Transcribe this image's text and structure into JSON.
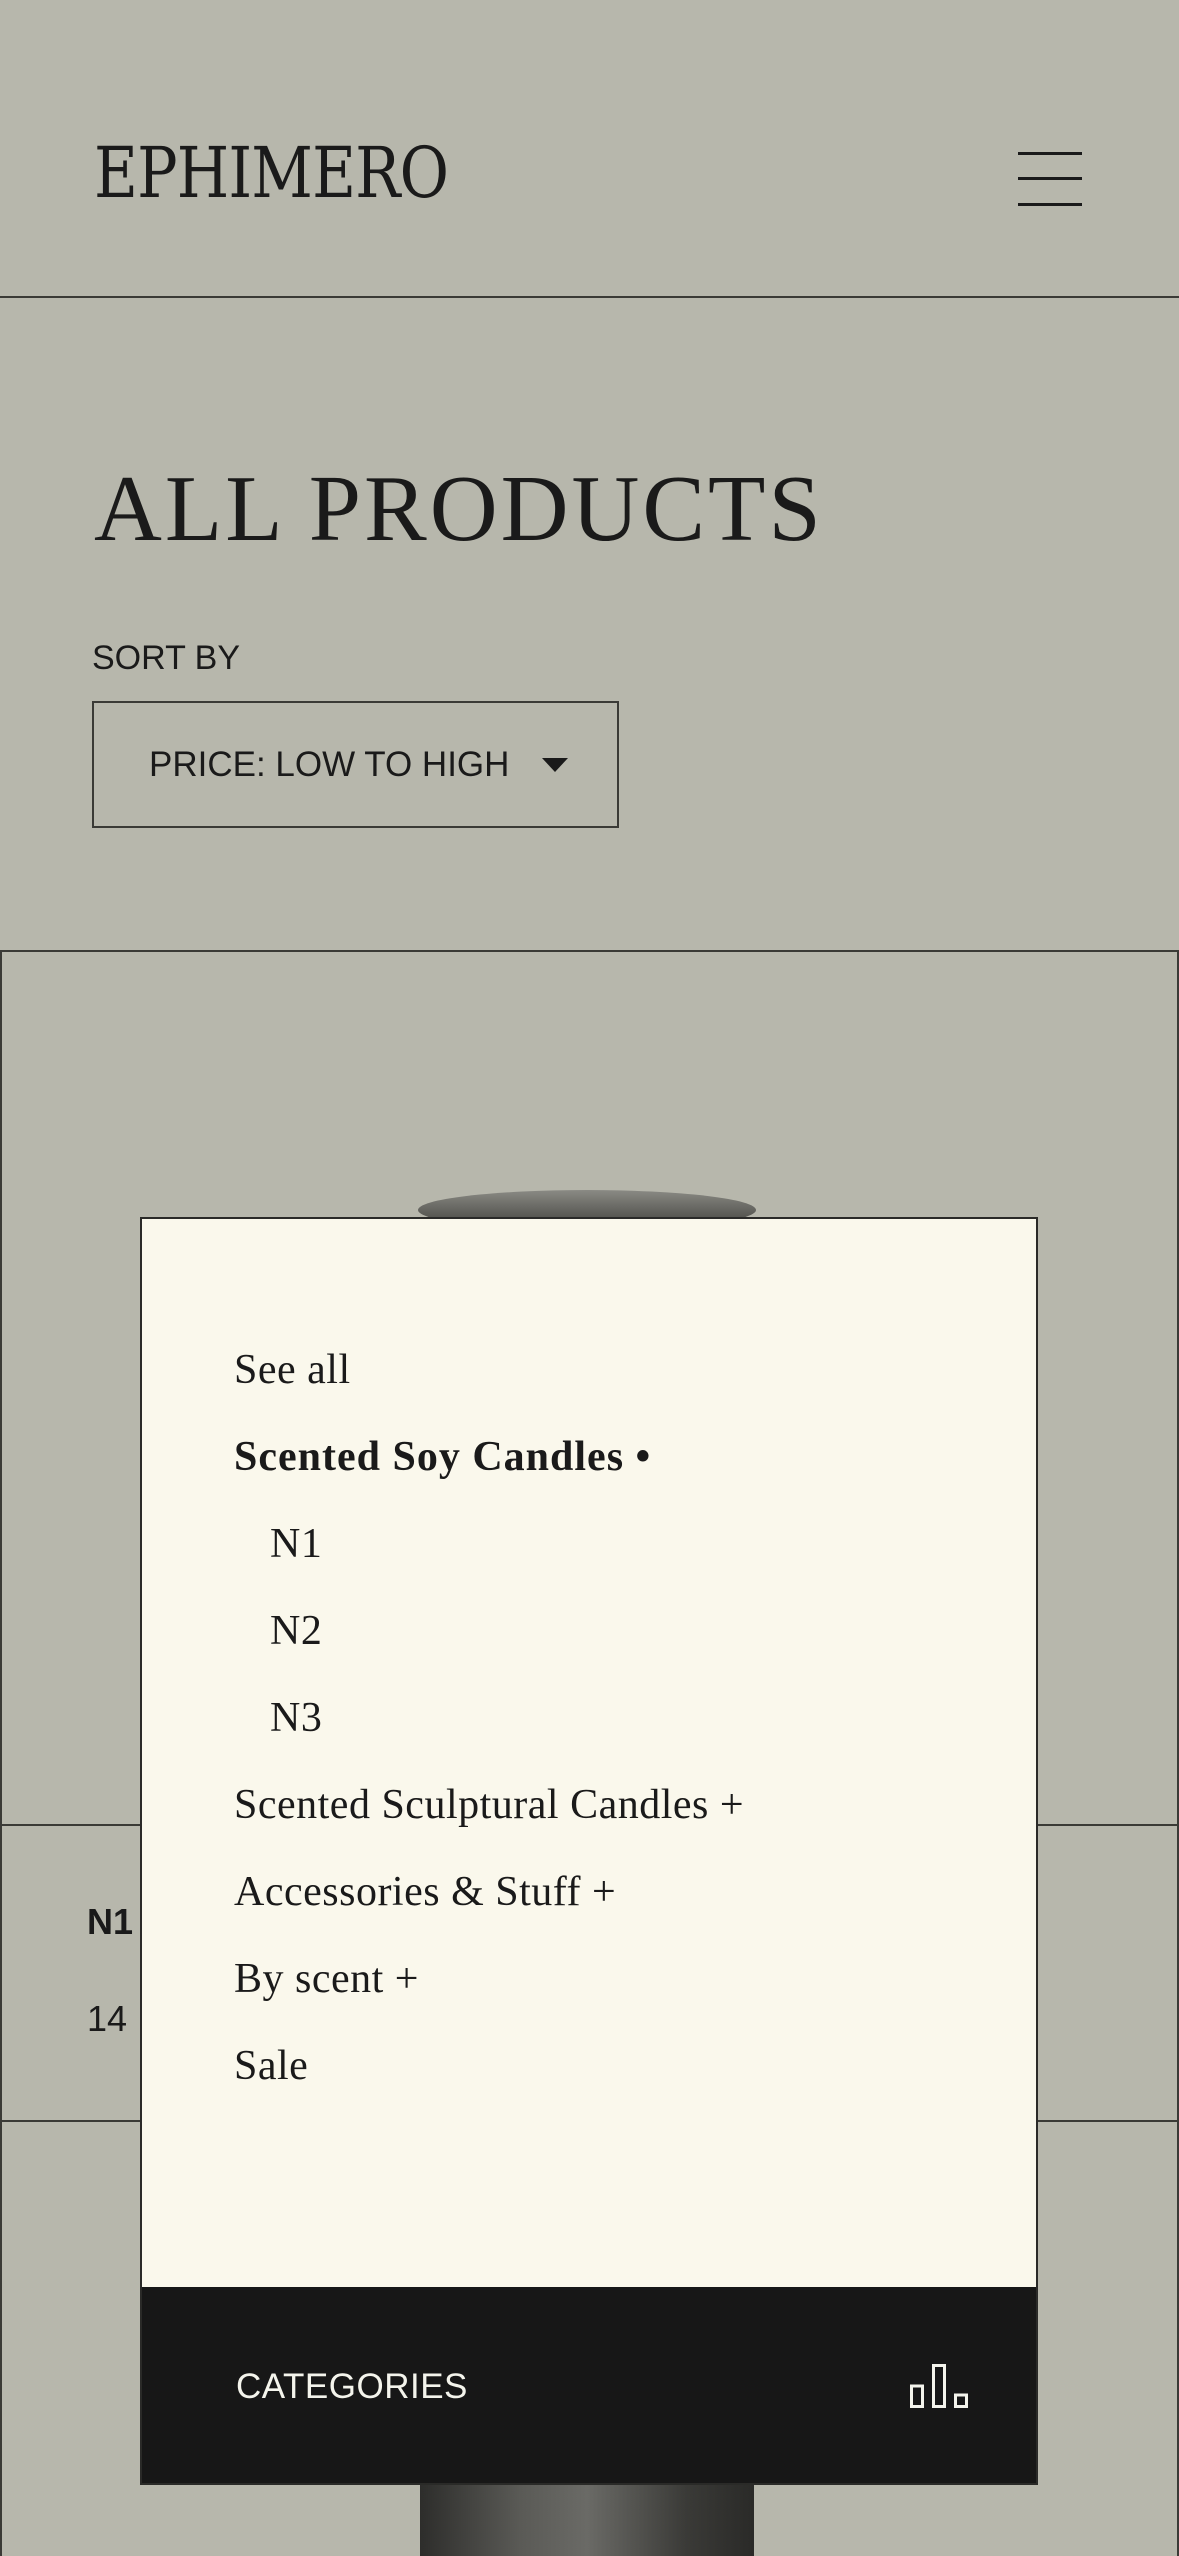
{
  "brand": {
    "logo_text": "EPHIMERO"
  },
  "page": {
    "title": "ALL PRODUCTS"
  },
  "sort": {
    "label": "SORT BY",
    "selected": "PRICE: LOW TO HIGH"
  },
  "product": {
    "name": "N1",
    "price": "14"
  },
  "categories": {
    "items": [
      {
        "label": "See all"
      },
      {
        "label": "Scented Soy Candles  •"
      },
      {
        "label": "N1"
      },
      {
        "label": "N2"
      },
      {
        "label": "N3"
      },
      {
        "label": "Scented Sculptural Candles +"
      },
      {
        "label": "Accessories & Stuff +"
      },
      {
        "label": "By scent +"
      },
      {
        "label": "Sale"
      }
    ],
    "footer_label": "CATEGORIES"
  },
  "icons": {
    "menu": "hamburger-menu-icon",
    "caret": "caret-down-icon",
    "categories": "bar-chart-icon"
  },
  "colors": {
    "background": "#b7b7ac",
    "popup": "#faf8ec",
    "footer": "#171717",
    "text": "#1a1a1a"
  }
}
